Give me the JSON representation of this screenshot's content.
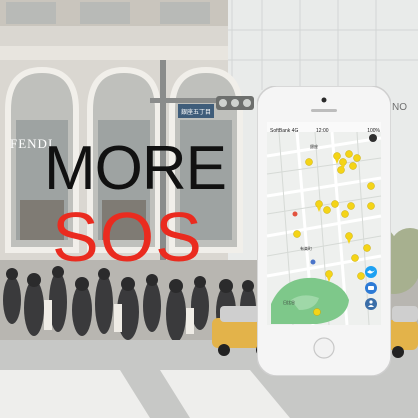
{
  "headline": {
    "line1": "MORE",
    "line2": "SOS"
  },
  "colors": {
    "accent_red": "#ea2b1f",
    "headline_black": "#111111",
    "pin_yellow": "#f4d417",
    "map_green": "#7ec88a",
    "twitter_blue": "#1da1f2",
    "phone_white": "#f7f7f7"
  },
  "storefront": {
    "sign": "FENDI",
    "street_sign": "銀座五丁目"
  },
  "phone": {
    "status": {
      "carrier": "SoftBank 4G",
      "time": "12:00",
      "battery": "100%"
    },
    "map_labels": [
      "銀座",
      "有楽町",
      "日比谷"
    ],
    "icons": [
      "twitter-icon",
      "camera-icon",
      "user-icon"
    ]
  }
}
